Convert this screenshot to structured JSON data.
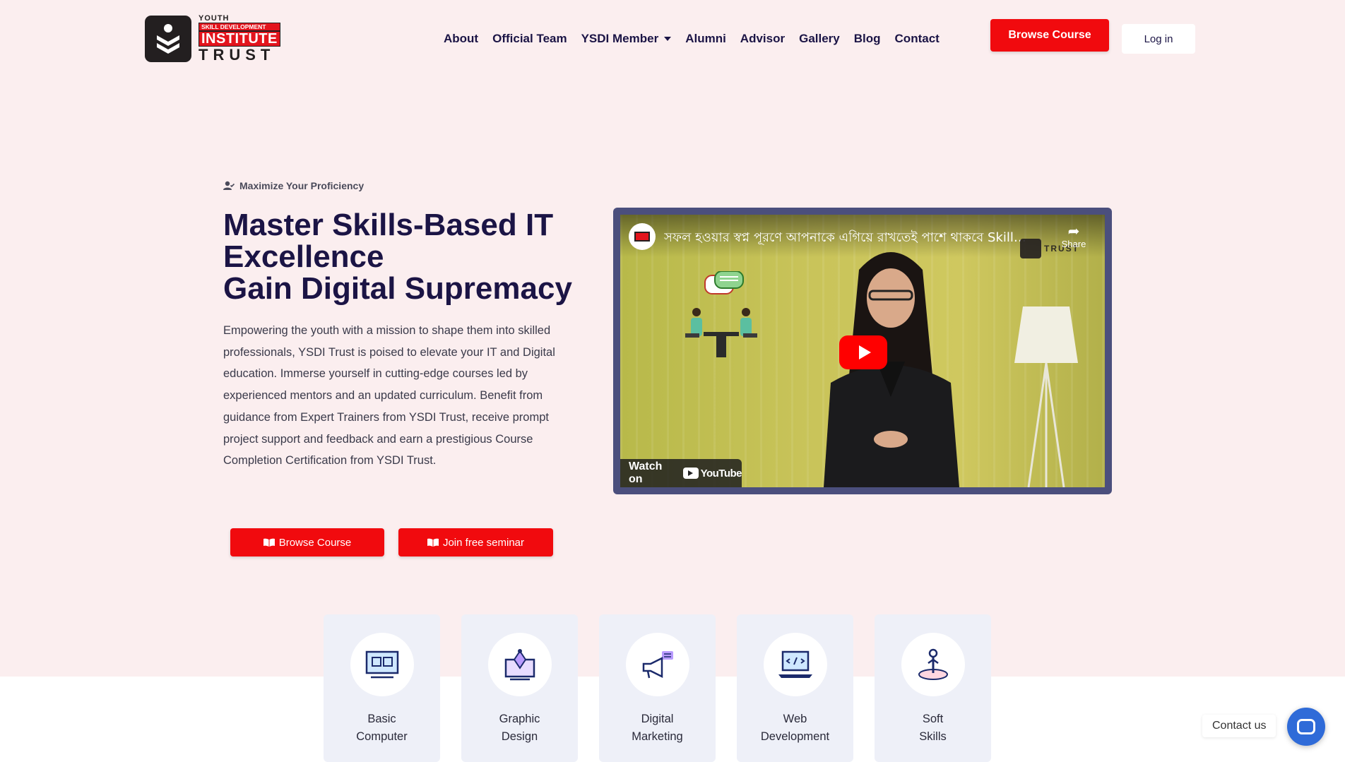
{
  "header": {
    "logo": {
      "youth": "YOUTH",
      "skill_development": "SKILL DEVELOPMENT",
      "institute": "INSTITUTE",
      "trust": "TRUST"
    },
    "nav": [
      {
        "label": "About"
      },
      {
        "label": "Official Team"
      },
      {
        "label": "YSDI Member",
        "has_dropdown": true
      },
      {
        "label": "Alumni"
      },
      {
        "label": "Advisor"
      },
      {
        "label": "Gallery"
      },
      {
        "label": "Blog"
      },
      {
        "label": "Contact"
      }
    ],
    "browse_button": "Browse Course",
    "login_button": "Log in"
  },
  "hero": {
    "eyebrow": "Maximize Your Proficiency",
    "headline_line1": "Master Skills-Based IT",
    "headline_line2": "Excellence",
    "headline_line3": "Gain Digital Supremacy",
    "description": "Empowering the youth with a mission to shape them into skilled professionals, YSDI Trust is poised to elevate your IT and Digital education. Immerse yourself in cutting-edge courses led by experienced mentors and an updated curriculum. Benefit from guidance from Expert Trainers from YSDI Trust, receive prompt project support and feedback and earn a prestigious Course Completion Certification from YSDI Trust.",
    "cta_browse": "Browse Course",
    "cta_seminar": "Join free seminar"
  },
  "video": {
    "title": "সফল হওয়ার স্বপ্ন পূরণে আপনাকে এগিয়ে রাখতেই পাশে থাকবে Skills...",
    "share_label": "Share",
    "watch_on": "Watch on",
    "youtube": "YouTube"
  },
  "courses": [
    {
      "line1": "Basic",
      "line2": "Computer",
      "icon": "computer-icon"
    },
    {
      "line1": "Graphic",
      "line2": "Design",
      "icon": "pen-tool-icon"
    },
    {
      "line1": "Digital",
      "line2": "Marketing",
      "icon": "megaphone-icon"
    },
    {
      "line1": "Web",
      "line2": "Development",
      "icon": "laptop-code-icon"
    },
    {
      "line1": "Soft",
      "line2": "Skills",
      "icon": "person-pin-icon"
    }
  ],
  "contact_widget": {
    "label": "Contact us"
  },
  "colors": {
    "accent_red": "#f10a0e",
    "headline": "#1b1445",
    "background": "#fbeeef",
    "video_frame": "#4b4f7d",
    "card_bg": "#eef0f8",
    "contact_blue": "#2f6bd8"
  }
}
